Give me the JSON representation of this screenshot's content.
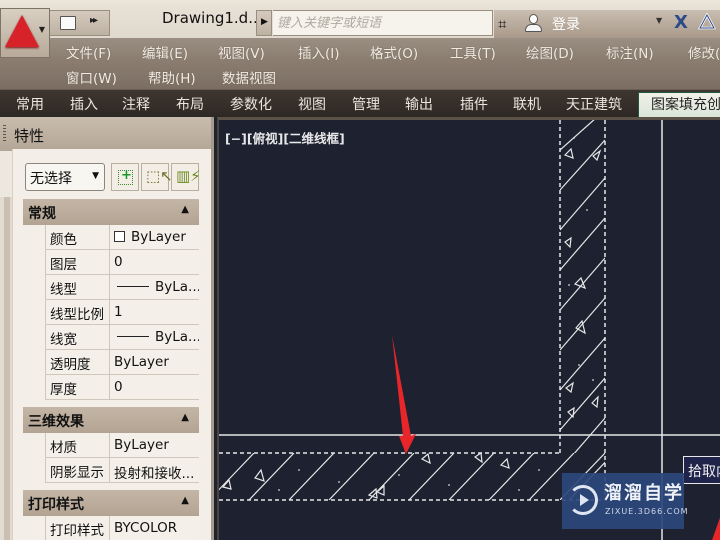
{
  "titlebar": {
    "document_title": "Drawing1.d...",
    "search_placeholder": "键入关键字或短语",
    "login_label": "登录"
  },
  "menubar": {
    "items": [
      "文件(F)",
      "编辑(E)",
      "视图(V)",
      "插入(I)",
      "格式(O)",
      "工具(T)",
      "绘图(D)",
      "标注(N)",
      "修改(",
      "窗口(W)",
      "帮助(H)",
      "数据视图"
    ]
  },
  "ribbon": {
    "tabs": [
      "常用",
      "插入",
      "注释",
      "布局",
      "参数化",
      "视图",
      "管理",
      "输出",
      "插件",
      "联机",
      "天正建筑",
      "图案填充创"
    ],
    "active_tab": "图案填充创"
  },
  "properties": {
    "title": "特性",
    "selection": "无选择",
    "sections": [
      {
        "title": "常规",
        "rows": [
          {
            "key": "颜色",
            "value": "ByLayer",
            "glyph": "swatch"
          },
          {
            "key": "图层",
            "value": "0"
          },
          {
            "key": "线型",
            "value": "ByLa...",
            "glyph": "line"
          },
          {
            "key": "线型比例",
            "value": "1"
          },
          {
            "key": "线宽",
            "value": "ByLa...",
            "glyph": "line"
          },
          {
            "key": "透明度",
            "value": "ByLayer"
          },
          {
            "key": "厚度",
            "value": "0"
          }
        ]
      },
      {
        "title": "三维效果",
        "rows": [
          {
            "key": "材质",
            "value": "ByLayer"
          },
          {
            "key": "阴影显示",
            "value": "投射和接收..."
          }
        ]
      },
      {
        "title": "打印样式",
        "rows": [
          {
            "key": "打印样式",
            "value": "BYCOLOR"
          }
        ]
      }
    ]
  },
  "canvas": {
    "view_label": "[−][俯视][二维线框]",
    "tooltip": "拾取内",
    "background_color": "#1e2230",
    "annotation_arrow_color": "#e8262a"
  },
  "watermark": {
    "title": "溜溜自学",
    "subtitle": "ZIXUE.3D66.COM"
  }
}
